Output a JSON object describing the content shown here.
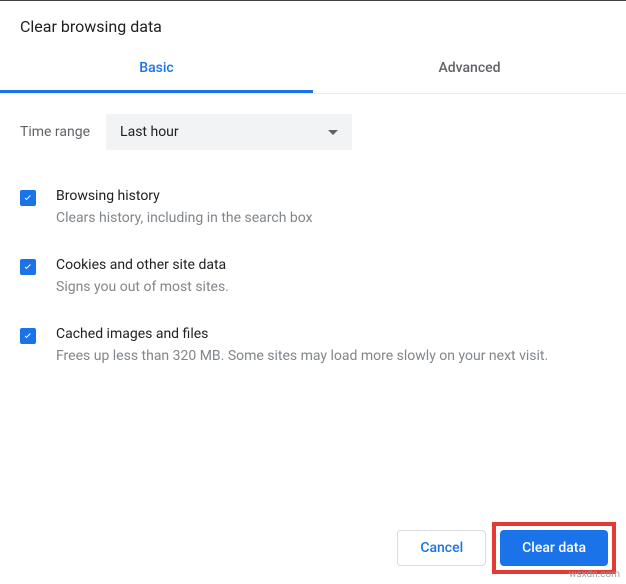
{
  "title": "Clear browsing data",
  "tabs": {
    "basic": "Basic",
    "advanced": "Advanced"
  },
  "timeRange": {
    "label": "Time range",
    "value": "Last hour"
  },
  "options": {
    "o0": {
      "title": "Browsing history",
      "desc": "Clears history, including in the search box"
    },
    "o1": {
      "title": "Cookies and other site data",
      "desc": "Signs you out of most sites."
    },
    "o2": {
      "title": "Cached images and files",
      "desc": "Frees up less than 320 MB. Some sites may load more slowly on your next visit."
    }
  },
  "buttons": {
    "cancel": "Cancel",
    "clear": "Clear data"
  },
  "watermark": "wsxdn.com"
}
